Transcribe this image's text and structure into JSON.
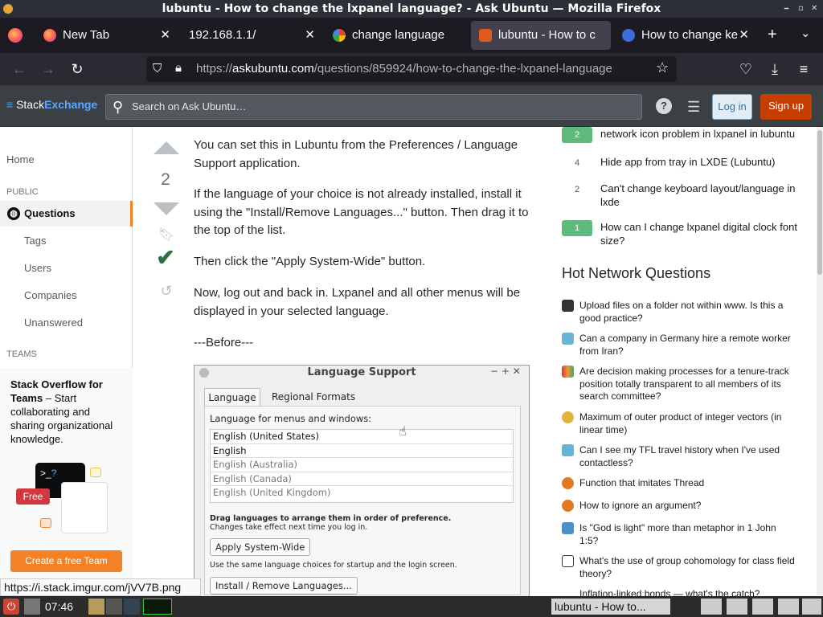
{
  "window": {
    "title": "lubuntu - How to change the lxpanel language? - Ask Ubuntu — Mozilla Firefox",
    "controls": [
      "⎯",
      "▫",
      "✕"
    ]
  },
  "tabs": [
    {
      "label": "New Tab",
      "icon": "firefox-icon"
    },
    {
      "label": "192.168.1.1/",
      "icon": "none"
    },
    {
      "label": "change language",
      "icon": "google-icon"
    },
    {
      "label": "lubuntu - How to c",
      "icon": "askubuntu-icon"
    },
    {
      "label": "How to change ke",
      "icon": "askubuntu-icon"
    }
  ],
  "nav": {
    "url_prefix": "https://",
    "url_domain": "askubuntu.com",
    "url_path": "/questions/859924/how-to-change-the-lxpanel-language"
  },
  "se_header": {
    "logo_a": "Stack",
    "logo_b": "Exchange",
    "search_placeholder": "Search on Ask Ubuntu…",
    "login_label": "Log in",
    "signup_label": "Sign up"
  },
  "leftnav": {
    "home": "Home",
    "public": "PUBLIC",
    "questions": "Questions",
    "tags": "Tags",
    "users": "Users",
    "companies": "Companies",
    "unanswered": "Unanswered",
    "teams": "TEAMS",
    "team_title": "Stack Overflow for Teams",
    "team_text": " – Start collaborating and sharing organizational knowledge.",
    "free_badge": "Free",
    "create_team": "Create a free Team"
  },
  "answer": {
    "score": "2",
    "p1": "You can set this in Lubuntu from the Preferences / Language Support application.",
    "p2": "If the language of your choice is not already installed, install it using the \"Install/Remove Languages...\" button. Then drag it to the top of the list.",
    "p3": "Then click the \"Apply System-Wide\" button.",
    "p4": "Now, log out and back in. Lxpanel and all other menus will be displayed in your selected language.",
    "p5": "---Before---"
  },
  "dialog": {
    "title": "Language Support",
    "tab1": "Language",
    "tab2": "Regional Formats",
    "label": "Language for menus and windows:",
    "langs": [
      "English (United States)",
      "English",
      "English (Australia)",
      "English (Canada)",
      "English (United Kingdom)"
    ],
    "drag_hint": "Drag languages to arrange them in order of preference.",
    "drag_sub": "Changes take effect next time you log in.",
    "apply_btn": "Apply System-Wide",
    "apply_hint": "Use the same language choices for startup and the login screen.",
    "install_btn": "Install / Remove Languages..."
  },
  "related": [
    {
      "count": "2",
      "title": "network icon problem in lxpanel in lubuntu",
      "accepted": true
    },
    {
      "count": "4",
      "title": "Hide app from tray in LXDE (Lubuntu)",
      "accepted": false
    },
    {
      "count": "2",
      "title": "Can't change keyboard layout/language in lxde",
      "accepted": false
    },
    {
      "count": "1",
      "title": "How can I change lxpanel digital clock font size?",
      "accepted": true
    }
  ],
  "hot_title": "Hot Network Questions",
  "hot": [
    "Upload files on a folder not within www. Is this a good practice?",
    "Can a company in Germany hire a remote worker from Iran?",
    "Are decision making processes for a tenure-track position totally transparent to all members of its search committee?",
    "Maximum of outer product of integer vectors (in linear time)",
    "Can I see my TFL travel history when I've used contactless?",
    "Function that imitates Thread",
    "How to ignore an argument?",
    "Is \"God is light\" more than metaphor in 1 John 1:5?",
    "What's the use of group cohomology for class field theory?",
    "Inflation-linked bonds — what's the catch?"
  ],
  "status_url": "https://i.stack.imgur.com/jVV7B.png",
  "taskbar": {
    "time": "07:46",
    "window_label": "lubuntu - How to..."
  },
  "colors": {
    "accent": "#f48225",
    "accepted": "#5eba7d",
    "se_header": "#3b4045",
    "login_bg": "#e1ecf4",
    "signup_bg": "#c63d00"
  }
}
